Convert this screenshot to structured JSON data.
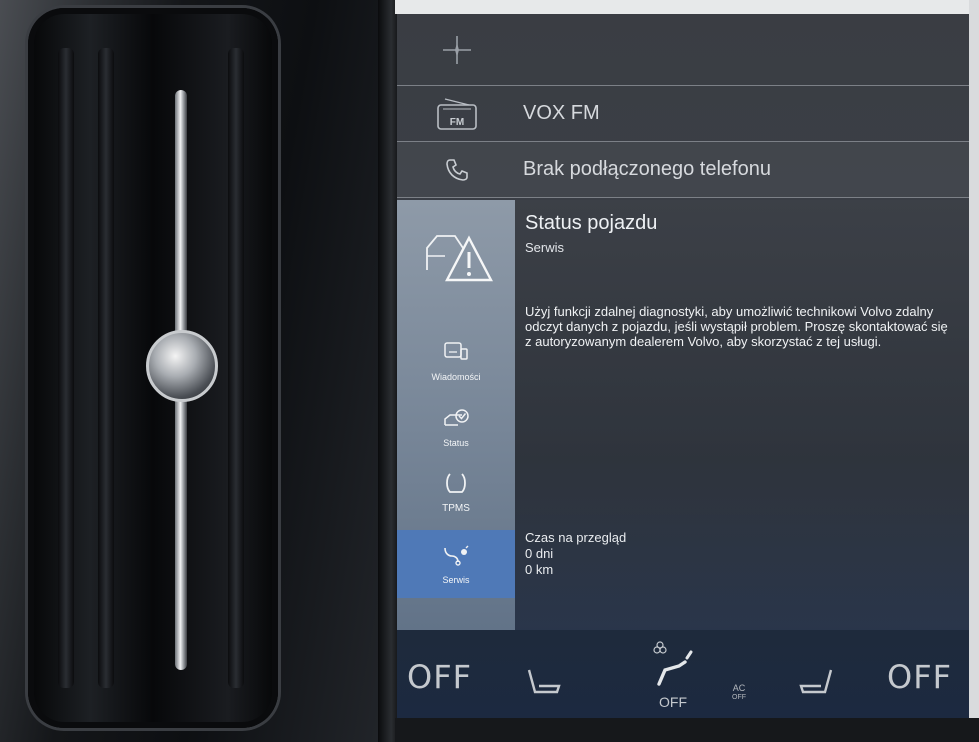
{
  "screen": {
    "rows": {
      "compass_icon": "compass-icon",
      "radio_icon_label": "FM",
      "radio_label": "VOX FM",
      "phone_label": "Brak podłączonego telefonu"
    },
    "status_card": {
      "title": "Status pojazdu",
      "subtitle": "Serwis",
      "body": "Użyj funkcji zdalnej diagnostyki, aby umożliwić technikowi Volvo zdalny odczyt danych z pojazdu, jeśli wystąpił problem. Proszę skontaktować się z autoryzowanym dealerem Volvo, aby skorzystać z tej usługi.",
      "service": {
        "label": "Czas na przegląd",
        "days": "0 dni",
        "km": "0 km"
      },
      "sidebar": {
        "items": [
          {
            "label": "Wiadomości",
            "icon": "messages-icon"
          },
          {
            "label": "Status",
            "icon": "car-status-icon"
          },
          {
            "label": "TPMS",
            "icon": "tpms-icon"
          },
          {
            "label": "Serwis",
            "icon": "service-wrench-icon",
            "active": true
          }
        ]
      }
    },
    "climate": {
      "left_temp": "OFF",
      "right_temp": "OFF",
      "fan_label": "OFF",
      "ac_label": "AC",
      "ac_sub": "OFF"
    }
  },
  "colors": {
    "active_tab": "#4f79b7",
    "sidebar": "#8e9aa8",
    "screen_bg": "#3a3d43"
  }
}
